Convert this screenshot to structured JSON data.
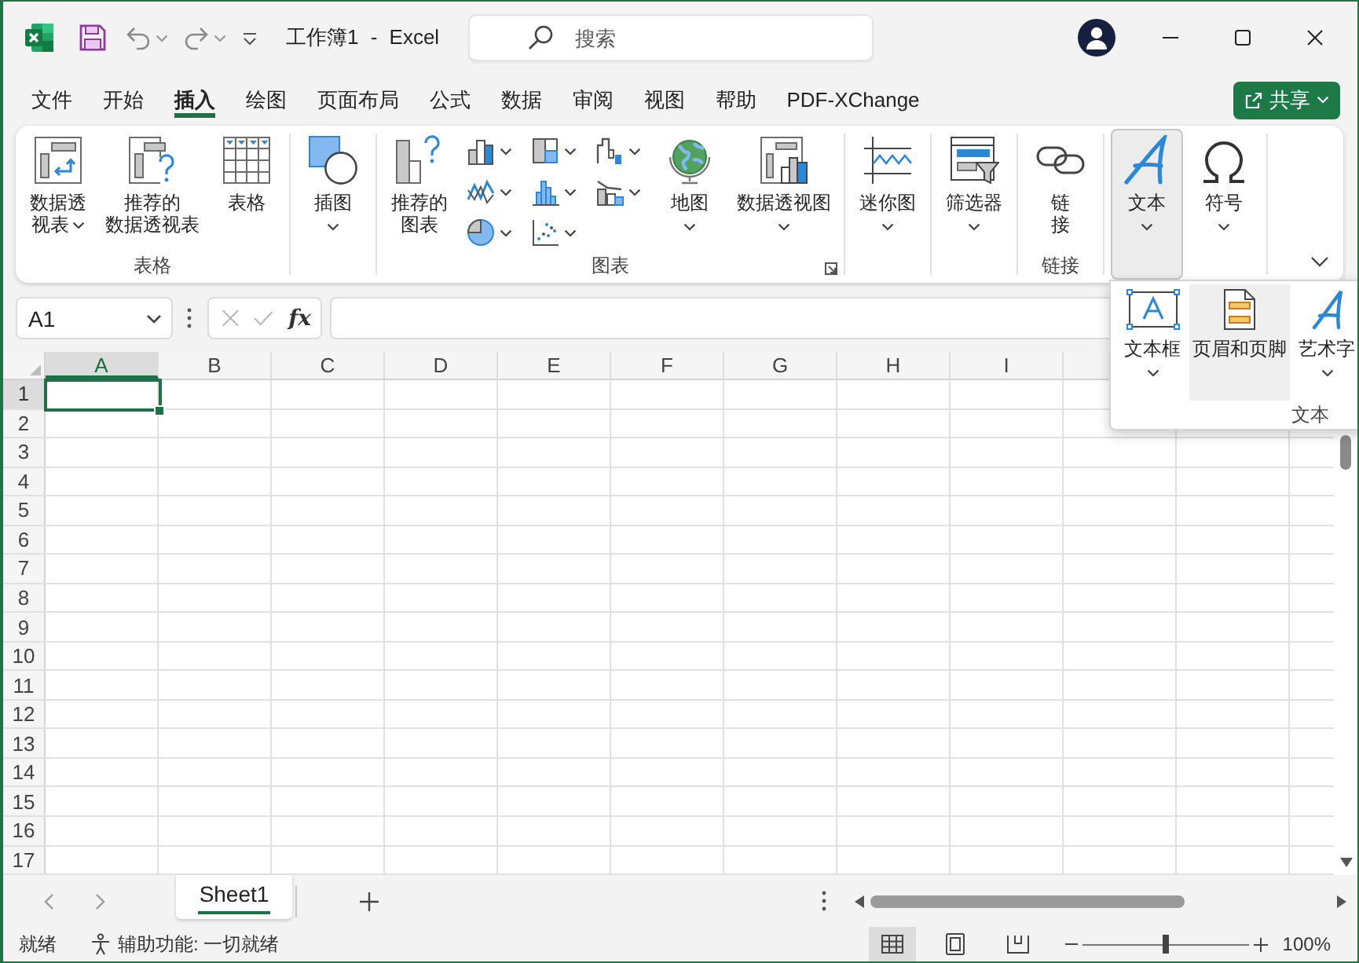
{
  "window": {
    "title": "工作簿1 - Excel",
    "search": {
      "placeholder": "搜索"
    }
  },
  "menu_tabs": [
    {
      "label": "文件",
      "selected": false
    },
    {
      "label": "开始",
      "selected": false
    },
    {
      "label": "插入",
      "selected": true
    },
    {
      "label": "绘图",
      "selected": false
    },
    {
      "label": "页面布局",
      "selected": false
    },
    {
      "label": "公式",
      "selected": false
    },
    {
      "label": "数据",
      "selected": false
    },
    {
      "label": "审阅",
      "selected": false
    },
    {
      "label": "视图",
      "selected": false
    },
    {
      "label": "帮助",
      "selected": false
    },
    {
      "label": "PDF-XChange",
      "selected": false
    }
  ],
  "share_button": {
    "label": "共享"
  },
  "ribbon": {
    "groups": [
      {
        "label": "表格",
        "buttons": [
          {
            "kind": "large",
            "label": "数据透视表",
            "dropdown": true,
            "pressed": false
          },
          {
            "kind": "large",
            "label": "推荐的数据透视表",
            "dropdown": false,
            "pressed": false
          },
          {
            "kind": "large",
            "label": "表格",
            "dropdown": false,
            "pressed": false
          }
        ]
      },
      {
        "buttons": [
          {
            "kind": "large",
            "label": "插图",
            "dropdown": true,
            "pressed": false
          }
        ]
      },
      {
        "label": "图表",
        "launcher": true,
        "buttons": [
          {
            "kind": "large",
            "label": "推荐的图表",
            "dropdown": false,
            "pressed": false
          },
          {
            "kind": "gallery"
          },
          {
            "kind": "large",
            "label": "地图",
            "dropdown": true,
            "pressed": false
          },
          {
            "kind": "large",
            "label": "数据透视图",
            "dropdown": true,
            "pressed": false
          }
        ]
      },
      {
        "buttons": [
          {
            "kind": "large",
            "label": "迷你图",
            "dropdown": true,
            "pressed": false
          }
        ]
      },
      {
        "buttons": [
          {
            "kind": "large",
            "label": "筛选器",
            "dropdown": true,
            "pressed": false
          }
        ]
      },
      {
        "label": "链接",
        "buttons": [
          {
            "kind": "large",
            "label": "链接",
            "dropdown": false,
            "pressed": false
          }
        ]
      },
      {
        "buttons": [
          {
            "kind": "large",
            "label": "文本",
            "dropdown": true,
            "pressed": true,
            "menu": {
              "label": "文本",
              "items": [
                {
                  "label": "文本框",
                  "dropdown": true,
                  "highlighted": false
                },
                {
                  "label": "页眉和页脚",
                  "dropdown": false,
                  "highlighted": true
                },
                {
                  "label": "艺术字",
                  "dropdown": true,
                  "highlighted": false
                }
              ]
            }
          },
          {
            "kind": "large",
            "label": "符号",
            "dropdown": true,
            "pressed": false
          }
        ]
      }
    ]
  },
  "formula_bar": {
    "name_box": "A1",
    "edit_buttons": [
      {
        "kind": "cancel",
        "disabled": true
      },
      {
        "kind": "enter",
        "disabled": true
      }
    ],
    "function_label": "fx"
  },
  "sheet": {
    "columns": [
      {
        "label": "A",
        "selected": true
      },
      {
        "label": "B",
        "selected": false
      },
      {
        "label": "C",
        "selected": false
      },
      {
        "label": "D",
        "selected": false
      },
      {
        "label": "E",
        "selected": false
      },
      {
        "label": "F",
        "selected": false
      },
      {
        "label": "G",
        "selected": false
      },
      {
        "label": "H",
        "selected": false
      },
      {
        "label": "I",
        "selected": false
      }
    ],
    "rows": [
      {
        "label": "1",
        "selected": true
      },
      {
        "label": "2",
        "selected": false
      },
      {
        "label": "3",
        "selected": false
      },
      {
        "label": "4",
        "selected": false
      },
      {
        "label": "5",
        "selected": false
      },
      {
        "label": "6",
        "selected": false
      },
      {
        "label": "7",
        "selected": false
      },
      {
        "label": "8",
        "selected": false
      },
      {
        "label": "9",
        "selected": false
      },
      {
        "label": "10",
        "selected": false
      },
      {
        "label": "11",
        "selected": false
      },
      {
        "label": "12",
        "selected": false
      },
      {
        "label": "13",
        "selected": false
      },
      {
        "label": "14",
        "selected": false
      },
      {
        "label": "15",
        "selected": false
      },
      {
        "label": "16",
        "selected": false
      },
      {
        "label": "17",
        "selected": false
      }
    ]
  },
  "sheet_tabs": [
    {
      "label": "Sheet1",
      "selected": true
    }
  ],
  "status_bar": {
    "status": "就绪",
    "accessibility": "辅助功能: 一切就绪",
    "views": [
      {
        "selected": true
      },
      {
        "selected": false
      },
      {
        "selected": false
      }
    ],
    "zoom": {
      "level": 0.5,
      "reading": "100%"
    }
  }
}
